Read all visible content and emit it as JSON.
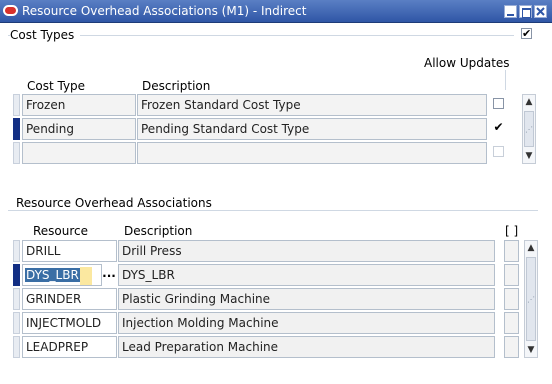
{
  "window": {
    "title": "Resource Overhead Associations (M1) - Indirect"
  },
  "cost_types": {
    "section_label": "Cost Types",
    "section_checked": true,
    "allow_updates_label": "Allow Updates",
    "columns": {
      "cost_type": "Cost Type",
      "description": "Description"
    },
    "rows": [
      {
        "cost_type": "Frozen",
        "description": "Frozen Standard Cost Type",
        "allow_updates": false
      },
      {
        "cost_type": "Pending",
        "description": "Pending Standard Cost Type",
        "allow_updates": true
      },
      {
        "cost_type": "",
        "description": "",
        "allow_updates": false
      }
    ]
  },
  "associations": {
    "section_label": "Resource Overhead Associations",
    "columns": {
      "resource": "Resource",
      "description": "Description",
      "flex": "[ ]"
    },
    "rows": [
      {
        "resource": "DRILL",
        "description": "Drill Press"
      },
      {
        "resource": "DYS_LBR",
        "description": "DYS_LBR"
      },
      {
        "resource": "GRINDER",
        "description": "Plastic Grinding Machine"
      },
      {
        "resource": "INJECTMOLD",
        "description": "Injection Molding Machine"
      },
      {
        "resource": "LEADPREP",
        "description": "Lead Preparation Machine"
      }
    ],
    "lov_button_label": "..."
  },
  "check_mark": "✔",
  "icons": [
    "oracle-logo-icon",
    "minimize-icon",
    "maximize-icon",
    "close-icon",
    "scroll-up-icon",
    "scroll-down-icon"
  ]
}
